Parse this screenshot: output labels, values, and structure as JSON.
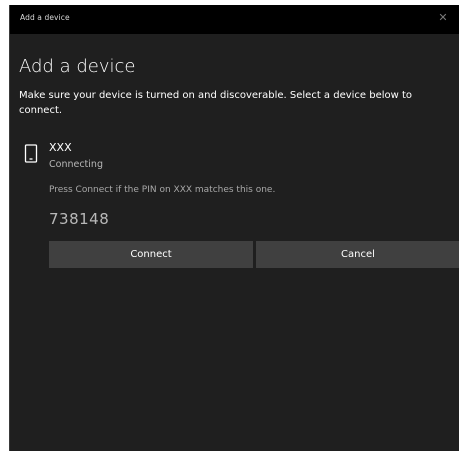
{
  "window": {
    "title": "Add a device",
    "close_glyph": "✕"
  },
  "main": {
    "heading": "Add a device",
    "instructions": "Make sure your device is turned on and discoverable. Select a device below to connect."
  },
  "device": {
    "icon": "phone-icon",
    "name": "XXX",
    "status": "Connecting",
    "pin_prompt": "Press Connect if the PIN on XXX matches this one.",
    "pin": "738148"
  },
  "buttons": {
    "connect_label": "Connect",
    "cancel_label": "Cancel"
  },
  "colors": {
    "background": "#1f1f1f",
    "titlebar": "#000000",
    "button": "#404040",
    "text": "#ffffff",
    "muted_text": "#b6b6b6"
  }
}
